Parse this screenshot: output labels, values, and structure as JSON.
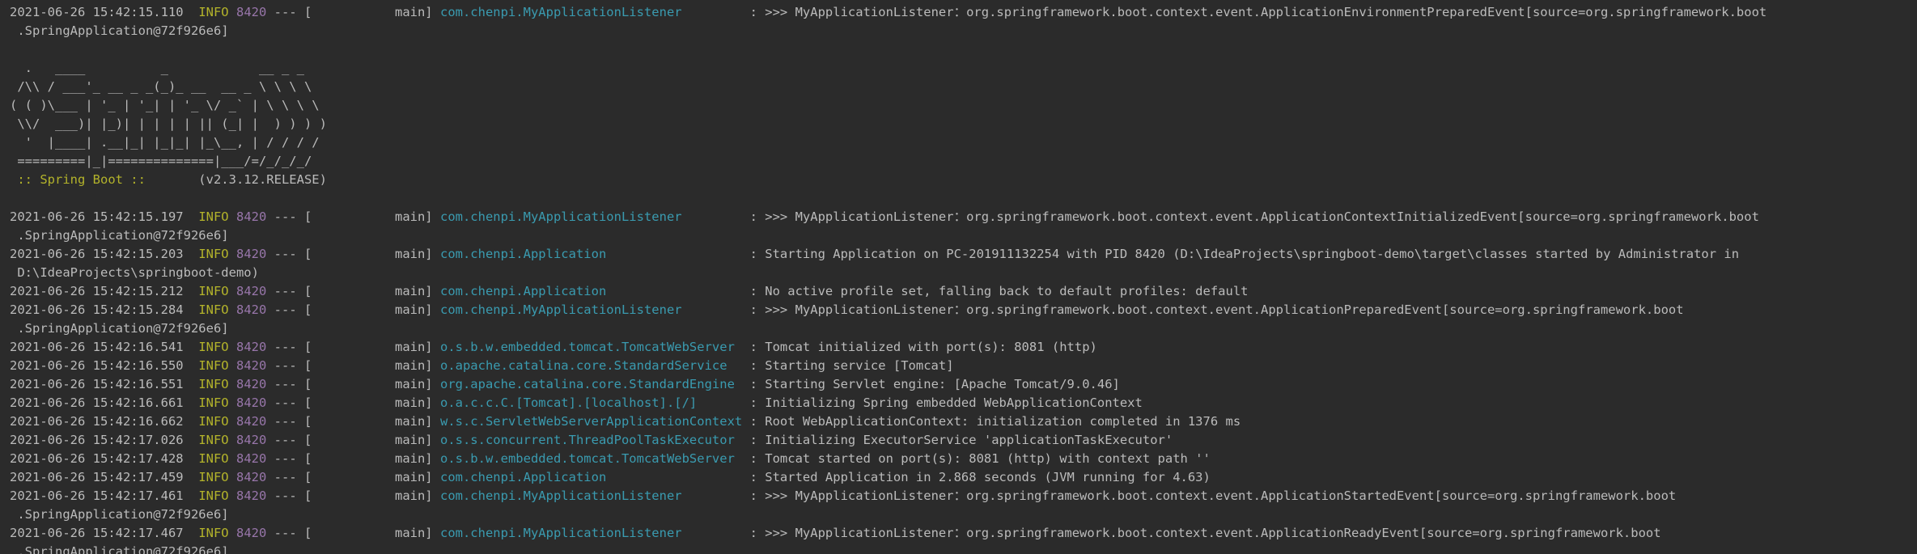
{
  "console": {
    "lines": [
      {
        "kind": "log",
        "ts": "2021-06-26 15:42:15.110",
        "level": "INFO",
        "pid": "8420",
        "sep": "---",
        "thread": "[           main]",
        "logger": "com.chenpi.MyApplicationListener",
        "message": ": >>> MyApplicationListener：org.springframework.boot.context.event.ApplicationEnvironmentPreparedEvent[source=org.springframework.boot"
      },
      {
        "kind": "plain",
        "text": " .SpringApplication@72f926e6]"
      },
      {
        "kind": "blank"
      },
      {
        "kind": "banner",
        "text": "  .   ____          _            __ _ _"
      },
      {
        "kind": "banner",
        "text": " /\\\\ / ___'_ __ _ _(_)_ __  __ _ \\ \\ \\ \\"
      },
      {
        "kind": "banner",
        "text": "( ( )\\___ | '_ | '_| | '_ \\/ _` | \\ \\ \\ \\"
      },
      {
        "kind": "banner",
        "text": " \\\\/  ___)| |_)| | | | | || (_| |  ) ) ) )"
      },
      {
        "kind": "banner",
        "text": "  '  |____| .__|_| |_|_| |_\\__, | / / / /"
      },
      {
        "kind": "banner",
        "text": " =========|_|==============|___/=/_/_/_/"
      },
      {
        "kind": "springboot",
        "tag": " :: Spring Boot :: ",
        "version": "      (v2.3.12.RELEASE)"
      },
      {
        "kind": "blank"
      },
      {
        "kind": "log",
        "ts": "2021-06-26 15:42:15.197",
        "level": "INFO",
        "pid": "8420",
        "sep": "---",
        "thread": "[           main]",
        "logger": "com.chenpi.MyApplicationListener",
        "message": ": >>> MyApplicationListener：org.springframework.boot.context.event.ApplicationContextInitializedEvent[source=org.springframework.boot"
      },
      {
        "kind": "plain",
        "text": " .SpringApplication@72f926e6]"
      },
      {
        "kind": "log",
        "ts": "2021-06-26 15:42:15.203",
        "level": "INFO",
        "pid": "8420",
        "sep": "---",
        "thread": "[           main]",
        "logger": "com.chenpi.Application",
        "message": ": Starting Application on PC-201911132254 with PID 8420 (D:\\IdeaProjects\\springboot-demo\\target\\classes started by Administrator in"
      },
      {
        "kind": "plain",
        "text": " D:\\IdeaProjects\\springboot-demo)"
      },
      {
        "kind": "log",
        "ts": "2021-06-26 15:42:15.212",
        "level": "INFO",
        "pid": "8420",
        "sep": "---",
        "thread": "[           main]",
        "logger": "com.chenpi.Application",
        "message": ": No active profile set, falling back to default profiles: default"
      },
      {
        "kind": "log",
        "ts": "2021-06-26 15:42:15.284",
        "level": "INFO",
        "pid": "8420",
        "sep": "---",
        "thread": "[           main]",
        "logger": "com.chenpi.MyApplicationListener",
        "message": ": >>> MyApplicationListener：org.springframework.boot.context.event.ApplicationPreparedEvent[source=org.springframework.boot"
      },
      {
        "kind": "plain",
        "text": " .SpringApplication@72f926e6]"
      },
      {
        "kind": "log",
        "ts": "2021-06-26 15:42:16.541",
        "level": "INFO",
        "pid": "8420",
        "sep": "---",
        "thread": "[           main]",
        "logger": "o.s.b.w.embedded.tomcat.TomcatWebServer",
        "message": ": Tomcat initialized with port(s): 8081 (http)"
      },
      {
        "kind": "log",
        "ts": "2021-06-26 15:42:16.550",
        "level": "INFO",
        "pid": "8420",
        "sep": "---",
        "thread": "[           main]",
        "logger": "o.apache.catalina.core.StandardService",
        "message": ": Starting service [Tomcat]"
      },
      {
        "kind": "log",
        "ts": "2021-06-26 15:42:16.551",
        "level": "INFO",
        "pid": "8420",
        "sep": "---",
        "thread": "[           main]",
        "logger": "org.apache.catalina.core.StandardEngine",
        "message": ": Starting Servlet engine: [Apache Tomcat/9.0.46]"
      },
      {
        "kind": "log",
        "ts": "2021-06-26 15:42:16.661",
        "level": "INFO",
        "pid": "8420",
        "sep": "---",
        "thread": "[           main]",
        "logger": "o.a.c.c.C.[Tomcat].[localhost].[/]",
        "message": ": Initializing Spring embedded WebApplicationContext"
      },
      {
        "kind": "log",
        "ts": "2021-06-26 15:42:16.662",
        "level": "INFO",
        "pid": "8420",
        "sep": "---",
        "thread": "[           main]",
        "logger": "w.s.c.ServletWebServerApplicationContext",
        "message": ": Root WebApplicationContext: initialization completed in 1376 ms"
      },
      {
        "kind": "log",
        "ts": "2021-06-26 15:42:17.026",
        "level": "INFO",
        "pid": "8420",
        "sep": "---",
        "thread": "[           main]",
        "logger": "o.s.s.concurrent.ThreadPoolTaskExecutor",
        "message": ": Initializing ExecutorService 'applicationTaskExecutor'"
      },
      {
        "kind": "log",
        "ts": "2021-06-26 15:42:17.428",
        "level": "INFO",
        "pid": "8420",
        "sep": "---",
        "thread": "[           main]",
        "logger": "o.s.b.w.embedded.tomcat.TomcatWebServer",
        "message": ": Tomcat started on port(s): 8081 (http) with context path ''"
      },
      {
        "kind": "log",
        "ts": "2021-06-26 15:42:17.459",
        "level": "INFO",
        "pid": "8420",
        "sep": "---",
        "thread": "[           main]",
        "logger": "com.chenpi.Application",
        "message": ": Started Application in 2.868 seconds (JVM running for 4.63)"
      },
      {
        "kind": "log",
        "ts": "2021-06-26 15:42:17.461",
        "level": "INFO",
        "pid": "8420",
        "sep": "---",
        "thread": "[           main]",
        "logger": "com.chenpi.MyApplicationListener",
        "message": ": >>> MyApplicationListener：org.springframework.boot.context.event.ApplicationStartedEvent[source=org.springframework.boot"
      },
      {
        "kind": "plain",
        "text": " .SpringApplication@72f926e6]"
      },
      {
        "kind": "log",
        "ts": "2021-06-26 15:42:17.467",
        "level": "INFO",
        "pid": "8420",
        "sep": "---",
        "thread": "[           main]",
        "logger": "com.chenpi.MyApplicationListener",
        "message": ": >>> MyApplicationListener：org.springframework.boot.context.event.ApplicationReadyEvent[source=org.springframework.boot"
      },
      {
        "kind": "plain",
        "text": " .SpringApplication@72f926e6]"
      }
    ]
  },
  "colors": {
    "background": "#2b2b2b",
    "text": "#bbbbbb",
    "level_info": "#b3b32b",
    "pid": "#9876aa",
    "logger": "#3a9bb0"
  }
}
